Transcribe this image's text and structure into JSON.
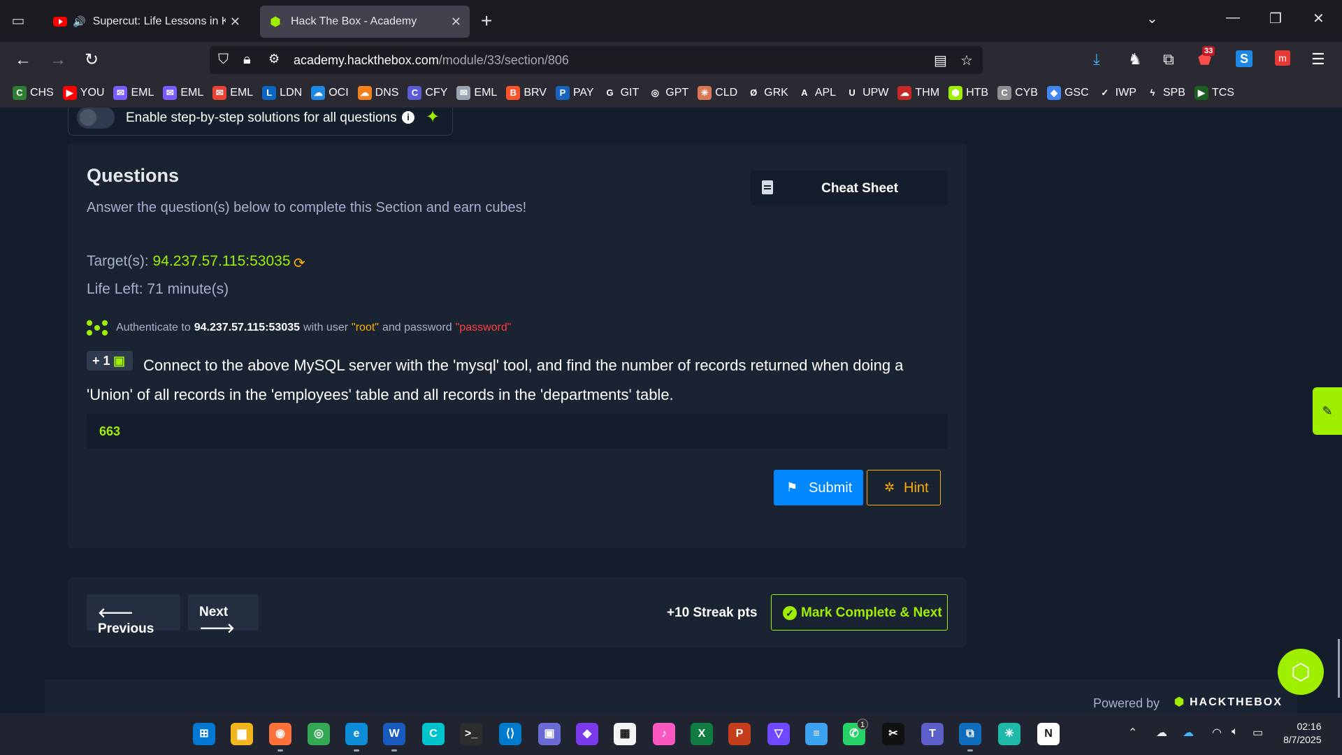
{
  "browser": {
    "tabs": [
      {
        "title": "Supercut: Life Lessons in Kee",
        "active": false,
        "audio": true
      },
      {
        "title": "Hack The Box - Academy",
        "active": true,
        "audio": false
      }
    ],
    "url_domain": "academy.hackthebox.com",
    "url_path": "/module/33/section/806",
    "extensions_badge": "33",
    "bookmarks": [
      "CHS",
      "YOU",
      "EML",
      "EML",
      "EML",
      "LDN",
      "OCI",
      "DNS",
      "CFY",
      "EML",
      "BRV",
      "PAY",
      "GIT",
      "GPT",
      "CLD",
      "GRK",
      "APL",
      "UPW",
      "THM",
      "HTB",
      "CYB",
      "GSC",
      "IWP",
      "SPB",
      "TCS"
    ],
    "bookmark_colors": [
      "#2e7d32",
      "#ff0000",
      "#7b5cff",
      "#7b5cff",
      "#ea4335",
      "#0a66c2",
      "#1e88e5",
      "#f48120",
      "#5b5bd6",
      "#9aa3b2",
      "#fb542b",
      "#1565c0",
      "#2b2a33",
      "#2b2a33",
      "#d97757",
      "#2b2a33",
      "#2b2a33",
      "#2b2a33",
      "#c62828",
      "#9fef00",
      "#8e8e8e",
      "#4285f4",
      "#2b2a33",
      "#2b2a33",
      "#1b5e20"
    ]
  },
  "page": {
    "toggle_label": "Enable step-by-step solutions for all questions",
    "questions_heading": "Questions",
    "questions_sub": "Answer the question(s) below to complete this Section and earn cubes!",
    "cheat_sheet_label": "Cheat Sheet",
    "target_label": "Target(s):",
    "target_ip": "94.237.57.115:53035",
    "life_left": "Life Left: 71 minute(s)",
    "auth_prefix": "Authenticate to",
    "auth_host": "94.237.57.115:53035",
    "auth_mid": "with user",
    "auth_user": "\"root\"",
    "auth_and": "and password",
    "auth_pass": "\"password\"",
    "points_badge": "+ 1",
    "question_text": "Connect to the above MySQL server with the 'mysql' tool, and find the number of records returned when doing a 'Union' of all records in the 'employees' table and all records in the 'departments' table.",
    "answer_value": "663",
    "submit_label": "Submit",
    "hint_label": "Hint",
    "prev_label": "Previous",
    "next_label": "Next",
    "streak_label": "+10 Streak pts",
    "mark_complete_label": "Mark Complete & Next",
    "powered_by": "Powered by",
    "htb_logo_text": "HACKTHEBOX"
  },
  "taskbar": {
    "apps": [
      "start",
      "file-explorer",
      "firefox",
      "chrome",
      "edge",
      "word",
      "canva",
      "terminal",
      "vscode",
      "notes",
      "obsidian",
      "store",
      "itunes",
      "excel",
      "powerpoint",
      "proton-vpn",
      "notepad",
      "whatsapp",
      "capcut",
      "teams",
      "remote-desktop",
      "perplexity",
      "notion"
    ],
    "whatsapp_badge": "1",
    "time": "02:16",
    "date": "8/7/2025"
  },
  "colors": {
    "accent_green": "#9fef00",
    "accent_blue": "#0086ff",
    "accent_orange": "#ffaf00",
    "accent_red": "#ff3e3e",
    "background": "#141d2b",
    "card": "#1a2332"
  }
}
